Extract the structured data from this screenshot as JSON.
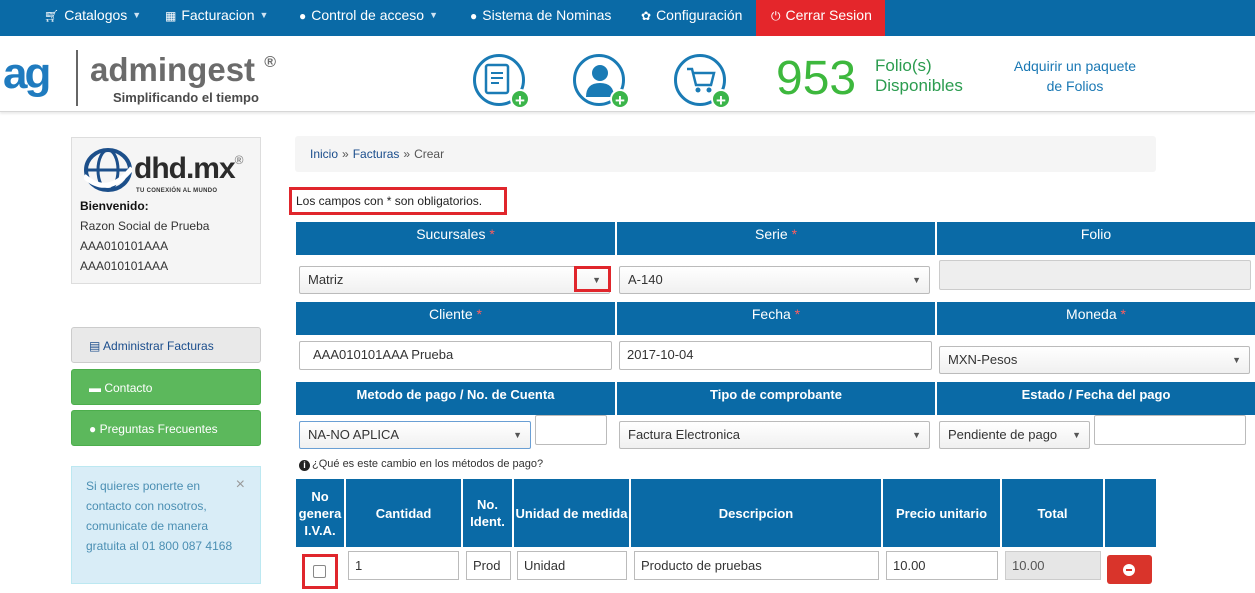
{
  "nav": {
    "items": [
      {
        "label": "Catalogos",
        "icon": "cart-icon"
      },
      {
        "label": "Facturacion",
        "icon": "qr-icon"
      },
      {
        "label": "Control de acceso",
        "icon": "user-icon"
      },
      {
        "label": "Sistema de Nominas",
        "icon": "user-icon"
      },
      {
        "label": "Configuración",
        "icon": "gear-icon"
      }
    ],
    "logout": "Cerrar Sesion"
  },
  "header": {
    "brand_short": "ag",
    "brand_name": "admingest",
    "brand_reg": "®",
    "tagline": "Simplificando el tiempo",
    "folio_count": "953",
    "folio_label_1": "Folio(s)",
    "folio_label_2": "Disponibles",
    "buy_1": "Adquirir un paquete",
    "buy_2": "de Folios"
  },
  "company": {
    "logo_name": "dhd.mx",
    "logo_reg": "®",
    "logo_tag": "TU CONEXIÓN AL MUNDO",
    "welcome": "Bienvenido:",
    "razon_social": "Razon Social de Prueba",
    "rfc_1": "AAA010101AAA",
    "rfc_2": "AAA010101AAA"
  },
  "sidebar": {
    "admin": "Administrar Facturas",
    "contacto": "Contacto",
    "faq": "Preguntas Frecuentes",
    "info": "Si quieres ponerte en contacto con nosotros, comunicate de manera gratuita al 01 800 087 4168",
    "info_close": "×"
  },
  "breadcrumb": {
    "home": "Inicio",
    "section": "Facturas",
    "current": "Crear",
    "sep": "»"
  },
  "form": {
    "required_note": "Los campos con * son obligatorios.",
    "required_mark": "*",
    "sucursales_label": "Sucursales",
    "serie_label": "Serie",
    "folio_label": "Folio",
    "cliente_label": "Cliente",
    "fecha_label": "Fecha",
    "moneda_label": "Moneda",
    "metodo_label": "Metodo de pago / No. de Cuenta",
    "tipo_label": "Tipo de comprobante",
    "estado_label": "Estado / Fecha del pago",
    "sucursal_value": "Matriz",
    "serie_value": "A-140",
    "folio_value": "",
    "cliente_value": "AAA010101AAA Prueba",
    "fecha_value": "2017-10-04",
    "moneda_value": "MXN-Pesos",
    "metodo_value": "NA-NO APLICA",
    "cuenta_value": "",
    "tipo_value": "Factura Electronica",
    "estado_value": "Pendiente de pago",
    "fecha_pago_value": "",
    "payment_question": "¿Qué es este cambio en los métodos de pago?"
  },
  "table": {
    "headers": {
      "no_iva": "No genera I.V.A.",
      "cantidad": "Cantidad",
      "no_ident": "No. Ident.",
      "unidad": "Unidad de medida",
      "descripcion": "Descripcion",
      "precio": "Precio unitario",
      "total": "Total"
    },
    "row": {
      "cantidad": "1",
      "no_ident": "Prod",
      "unidad": "Unidad",
      "descripcion": "Producto de pruebas",
      "precio": "10.00",
      "total": "10.00"
    }
  },
  "colors": {
    "primary": "#0a6aa6",
    "danger": "#e4262b",
    "success": "#5cb85c",
    "folio_green": "#3db83d"
  }
}
